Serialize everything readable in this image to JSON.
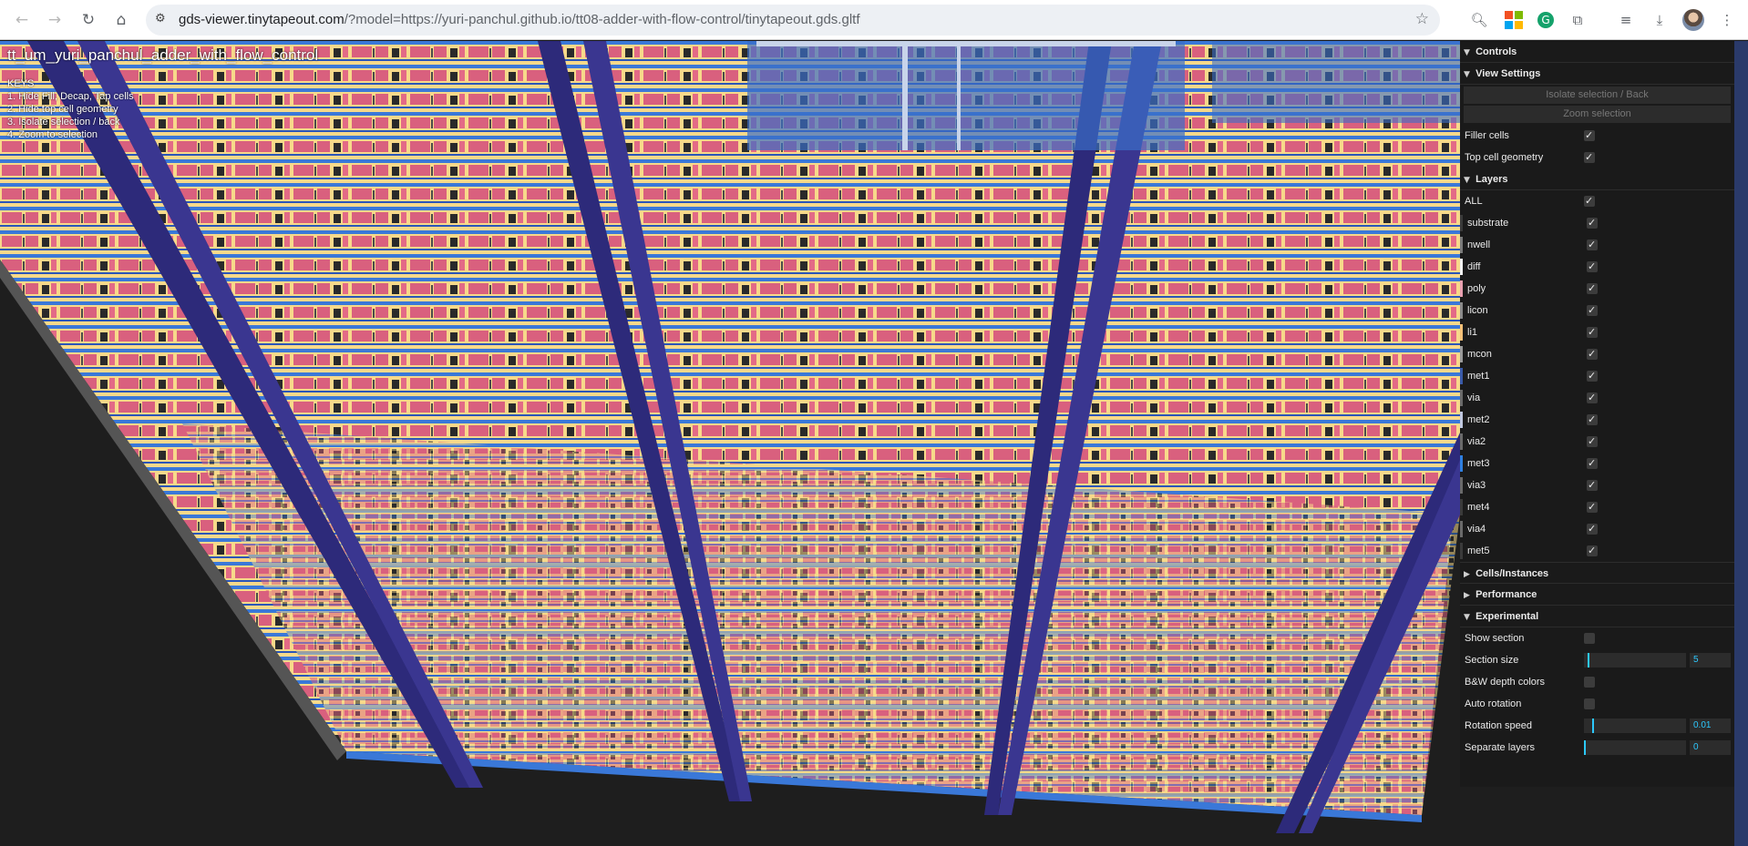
{
  "browser": {
    "url_host": "gds-viewer.tinytapeout.com",
    "url_path": "/?model=https://yuri-panchul.github.io/tt08-adder-with-flow-control/tinytapeout.gds.gltf",
    "nav_icons": [
      "back-icon",
      "forward-icon",
      "reload-icon",
      "home-icon"
    ],
    "ext_icons": [
      "lens-icon",
      "microsoft-icon",
      "grammarly-icon",
      "extensions-icon",
      "media-icon",
      "download-icon",
      "avatar",
      "more-icon"
    ]
  },
  "viewport": {
    "title": "tt_um_yuri_panchul_adder_with_flow_control",
    "keys_heading": "KEYS",
    "keys": [
      "1. Hide Fill, Decap, Tap cells",
      "2. Hide top cell geometry",
      "3. Isolate selection / back",
      "4. Zoom to selection"
    ]
  },
  "panel": {
    "controls": "Controls",
    "view_settings": {
      "title": "View Settings",
      "isolate_btn": "Isolate selection / Back",
      "zoom_btn": "Zoom selection",
      "filler_cells": {
        "label": "Filler cells",
        "checked": true
      },
      "top_cell_geometry": {
        "label": "Top cell geometry",
        "checked": true
      }
    },
    "layers": {
      "title": "Layers",
      "all": {
        "label": "ALL",
        "checked": true
      },
      "items": [
        {
          "label": "substrate",
          "color": "#3a3a3a"
        },
        {
          "label": "nwell",
          "color": "#7a7a7a"
        },
        {
          "label": "diff",
          "color": "#f2f2f2"
        },
        {
          "label": "poly",
          "color": "#e8a0b0"
        },
        {
          "label": "licon",
          "color": "#8a8a8a"
        },
        {
          "label": "li1",
          "color": "#f5c078"
        },
        {
          "label": "mcon",
          "color": "#9a9a9a"
        },
        {
          "label": "met1",
          "color": "#3a5aa8"
        },
        {
          "label": "via",
          "color": "#6a6a6a"
        },
        {
          "label": "met2",
          "color": "#c0c8e0"
        },
        {
          "label": "via2",
          "color": "#6a6a6a"
        },
        {
          "label": "met3",
          "color": "#2f7fe0"
        },
        {
          "label": "via3",
          "color": "#6a6a6a"
        },
        {
          "label": "met4",
          "color": "#3a3a3a"
        },
        {
          "label": "via4",
          "color": "#6a6a6a"
        },
        {
          "label": "met5",
          "color": "#3a3a3a"
        }
      ]
    },
    "cells_instances": "Cells/Instances",
    "performance": "Performance",
    "experimental": {
      "title": "Experimental",
      "show_section": {
        "label": "Show section",
        "checked": false
      },
      "section_size": {
        "label": "Section size",
        "value": "5",
        "fraction": 0.05
      },
      "bw_depth": {
        "label": "B&W depth colors",
        "checked": false
      },
      "auto_rotation": {
        "label": "Auto rotation",
        "checked": false
      },
      "rotation_speed": {
        "label": "Rotation speed",
        "value": "0.01",
        "fraction": 0.1
      },
      "separate_layers": {
        "label": "Separate layers",
        "value": "0",
        "fraction": 0.0
      }
    }
  }
}
